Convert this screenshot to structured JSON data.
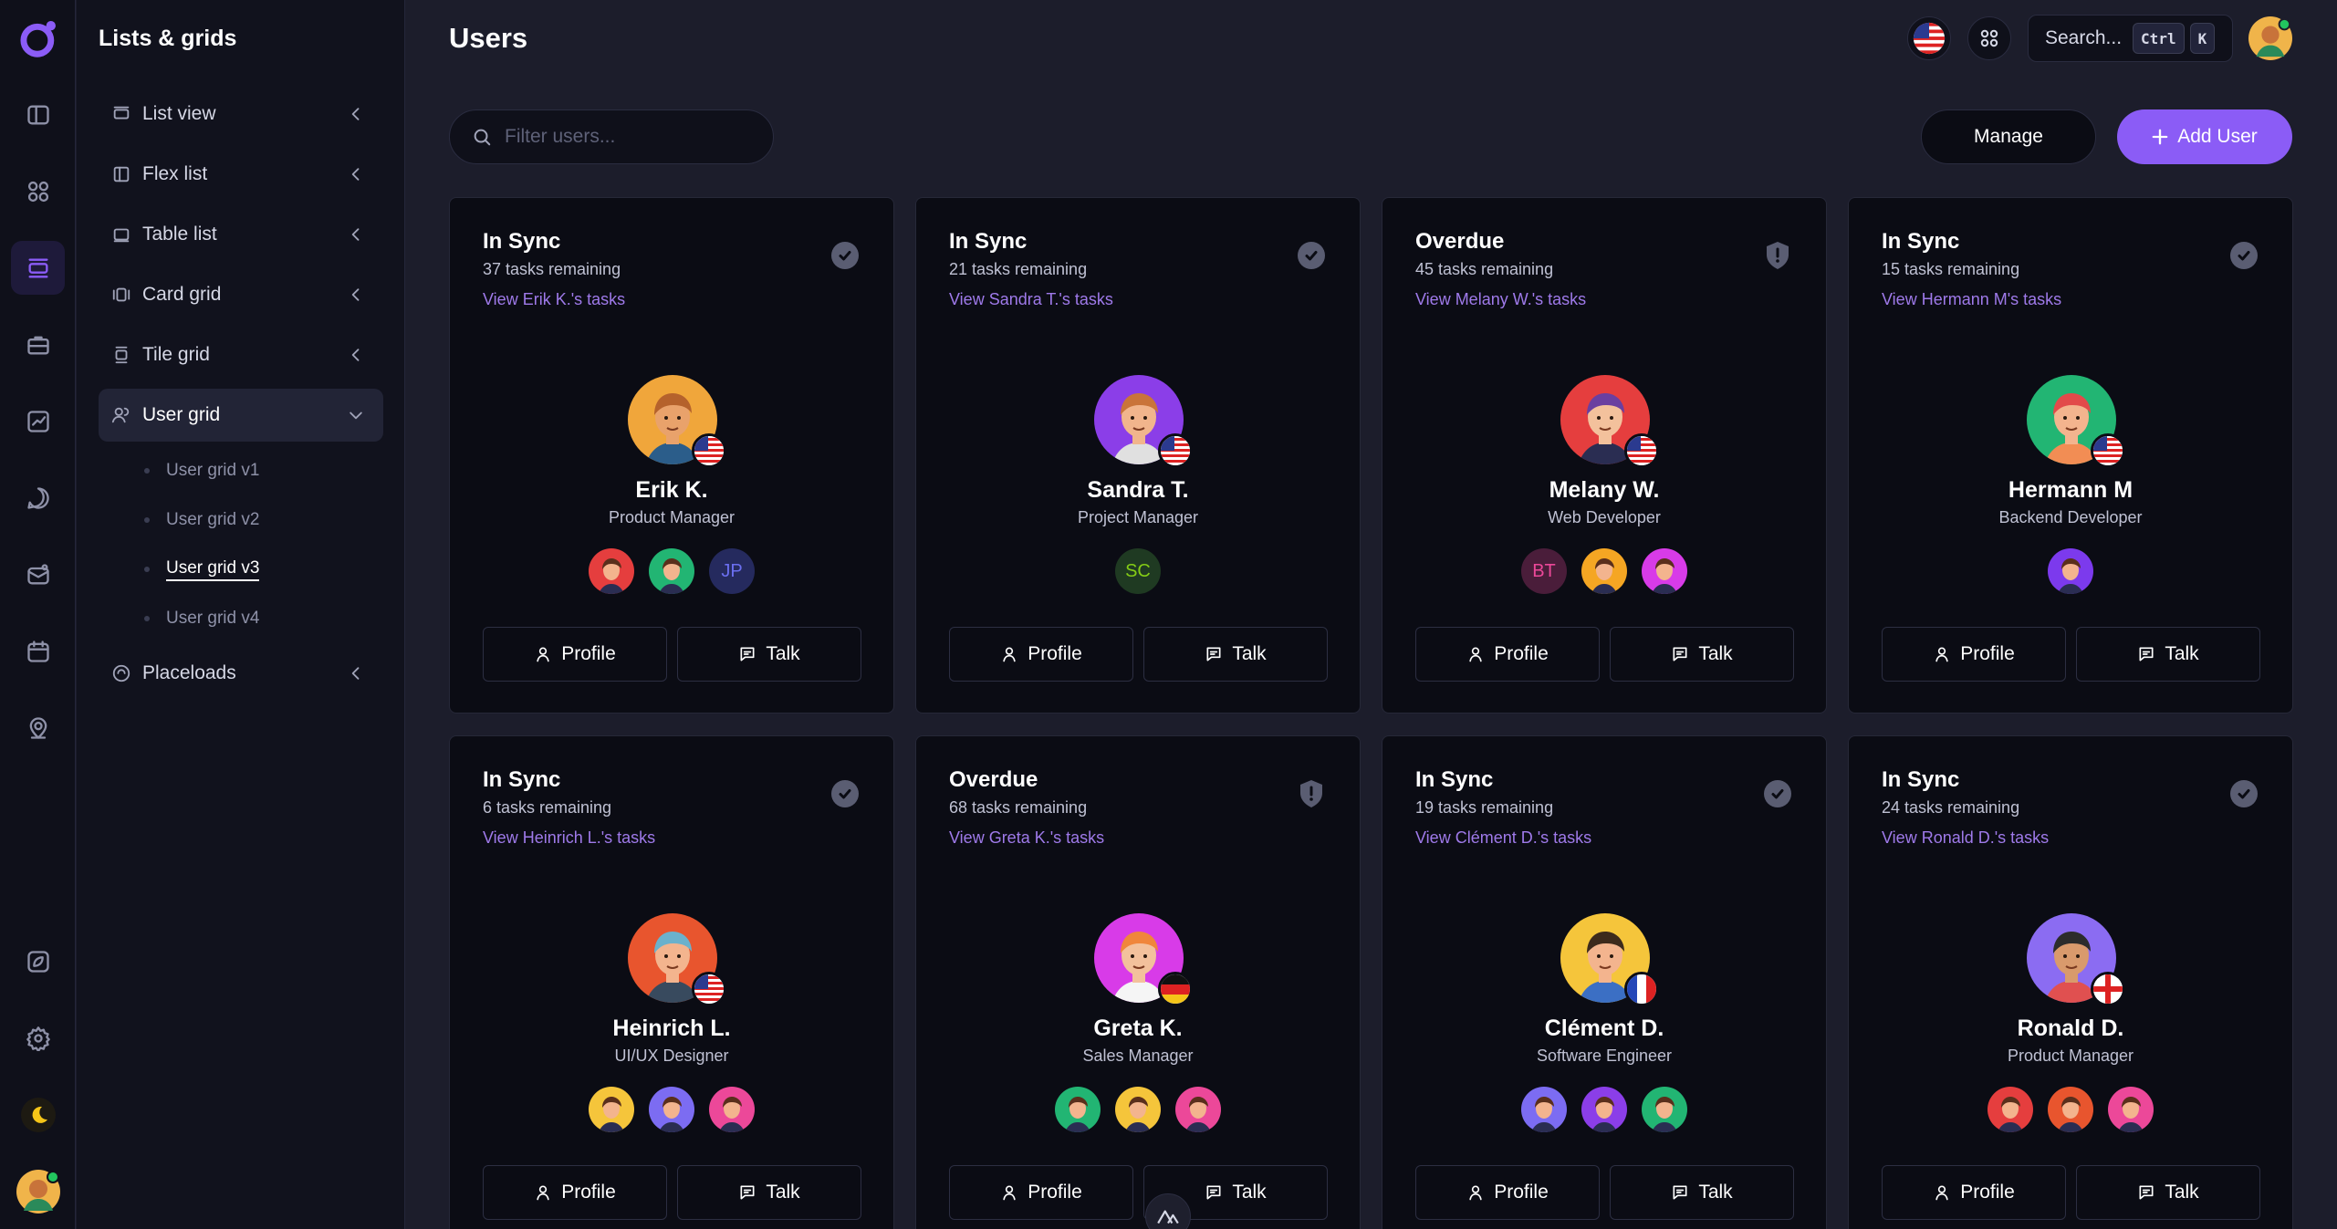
{
  "sidebar": {
    "title": "Lists & grids",
    "items": [
      {
        "label": "List view"
      },
      {
        "label": "Flex list"
      },
      {
        "label": "Table list"
      },
      {
        "label": "Card grid"
      },
      {
        "label": "Tile grid"
      },
      {
        "label": "User grid"
      },
      {
        "label": "Placeloads"
      }
    ],
    "user_grid_sub": [
      "User grid v1",
      "User grid v2",
      "User grid v3",
      "User grid v4"
    ]
  },
  "header": {
    "title": "Users",
    "search_label": "Search...",
    "kbd_ctrl": "Ctrl",
    "kbd_k": "K"
  },
  "toolbar": {
    "filter_placeholder": "Filter users...",
    "manage_label": "Manage",
    "add_label": "Add User"
  },
  "card_buttons": {
    "profile": "Profile",
    "talk": "Talk"
  },
  "colors": {
    "accent": "#8b5cf6",
    "link": "#9f7aea",
    "background": "#1c1d2b",
    "card": "#0b0c14"
  },
  "users": [
    {
      "status": "In Sync",
      "tasks": "37 tasks remaining",
      "link": "View Erik K.'s tasks",
      "name": "Erik K.",
      "role": "Product Manager",
      "status_icon": "check-icon",
      "flag": "us",
      "team": [
        "avatar",
        "avatar",
        "JP"
      ]
    },
    {
      "status": "In Sync",
      "tasks": "21 tasks remaining",
      "link": "View Sandra T.'s tasks",
      "name": "Sandra T.",
      "role": "Project Manager",
      "status_icon": "check-icon",
      "flag": "us",
      "team": [
        "SC"
      ]
    },
    {
      "status": "Overdue",
      "tasks": "45 tasks remaining",
      "link": "View Melany W.'s tasks",
      "name": "Melany W.",
      "role": "Web Developer",
      "status_icon": "shield-icon",
      "flag": "us",
      "team": [
        "BT",
        "avatar",
        "avatar"
      ]
    },
    {
      "status": "In Sync",
      "tasks": "15 tasks remaining",
      "link": "View Hermann M's tasks",
      "name": "Hermann M",
      "role": "Backend Developer",
      "status_icon": "check-icon",
      "flag": "us",
      "team": [
        "avatar"
      ]
    },
    {
      "status": "In Sync",
      "tasks": "6 tasks remaining",
      "link": "View Heinrich L.'s tasks",
      "name": "Heinrich L.",
      "role": "UI/UX Designer",
      "status_icon": "check-icon",
      "flag": "us",
      "team": [
        "avatar",
        "avatar",
        "avatar"
      ]
    },
    {
      "status": "Overdue",
      "tasks": "68 tasks remaining",
      "link": "View Greta K.'s tasks",
      "name": "Greta K.",
      "role": "Sales Manager",
      "status_icon": "shield-icon",
      "flag": "de",
      "team": [
        "avatar",
        "avatar",
        "avatar"
      ]
    },
    {
      "status": "In Sync",
      "tasks": "19 tasks remaining",
      "link": "View Clément D.'s tasks",
      "name": "Clément D.",
      "role": "Software Engineer",
      "status_icon": "check-icon",
      "flag": "fr",
      "team": [
        "avatar",
        "avatar",
        "avatar"
      ]
    },
    {
      "status": "In Sync",
      "tasks": "24 tasks remaining",
      "link": "View Ronald D.'s tasks",
      "name": "Ronald D.",
      "role": "Product Manager",
      "status_icon": "check-icon",
      "flag": "gb",
      "team": [
        "avatar",
        "avatar",
        "avatar"
      ]
    }
  ]
}
